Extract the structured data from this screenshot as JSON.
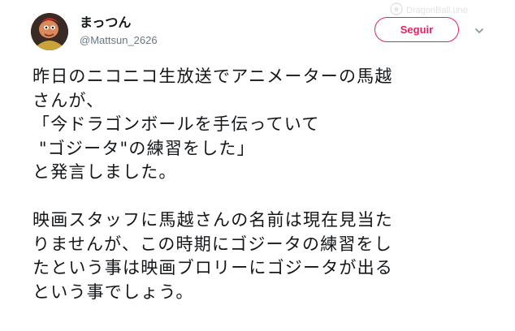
{
  "header": {
    "display_name": "まっつん",
    "handle": "@Mattsun_2626",
    "follow_label": "Seguir",
    "watermark": "DragonBall.uno",
    "accent_color": "#e0245e"
  },
  "icons": {
    "caret": "chevron-down-icon",
    "watermark": "dragonball-logo-icon"
  },
  "tweet": {
    "paragraph1": [
      "昨日のニコニコ生放送でアニメーターの馬越",
      "さんが、",
      "「今ドラゴンボールを手伝っていて",
      " \"ゴジータ\"の練習をした」",
      "と発言しました。"
    ],
    "paragraph2": [
      "映画スタッフに馬越さんの名前は現在見当た",
      "りませんが、この時期にゴジータの練習をし",
      "たという事は映画ブロリーにゴジータが出る",
      "という事でしょう。"
    ]
  }
}
